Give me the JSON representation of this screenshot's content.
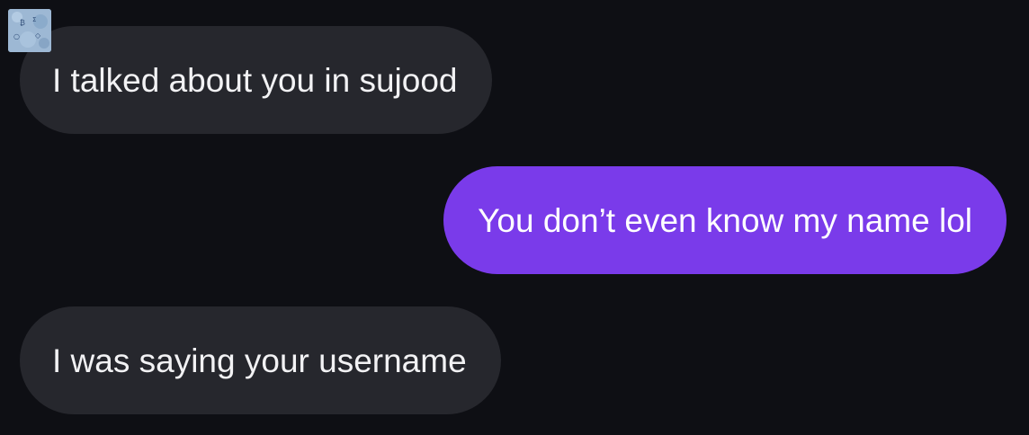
{
  "conversation": {
    "messages": [
      {
        "direction": "incoming",
        "text": "I talked about you in sujood"
      },
      {
        "direction": "outgoing",
        "text": "You don’t even know my name lol"
      },
      {
        "direction": "incoming",
        "text": "I was saying your username"
      }
    ]
  },
  "colors": {
    "background": "#0e0f14",
    "incoming_bubble": "#26272d",
    "outgoing_bubble": "#7a3bea",
    "text": "#f2f2f4"
  },
  "icons": {
    "avatar": "contact-avatar-icon"
  }
}
